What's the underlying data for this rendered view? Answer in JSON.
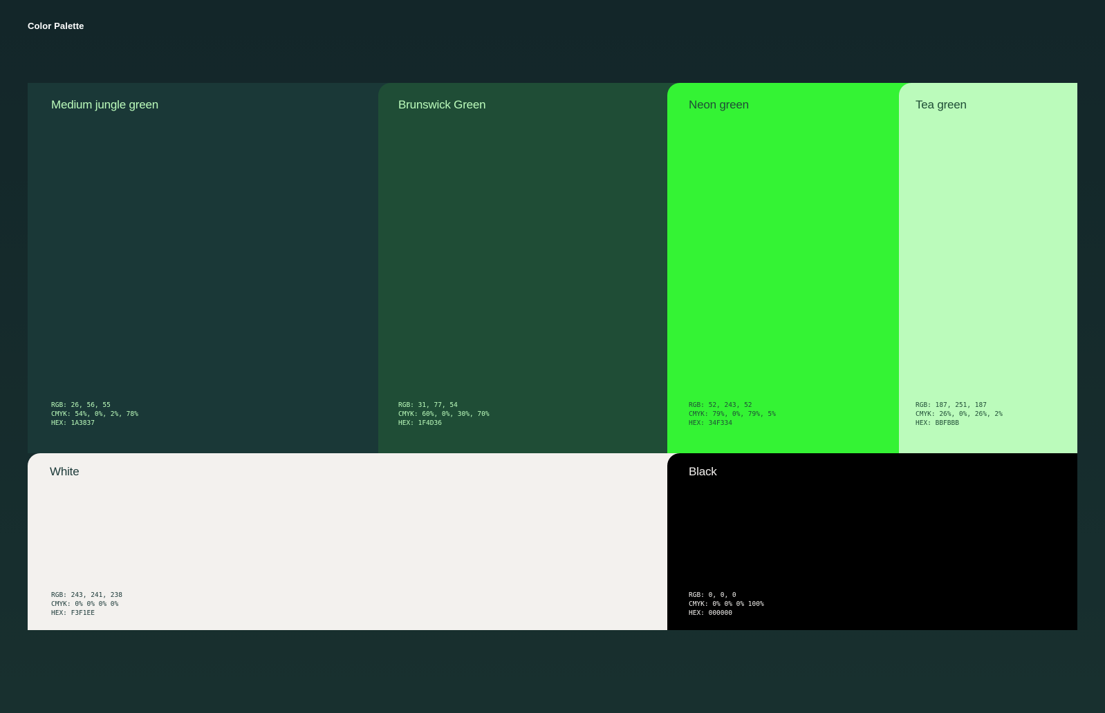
{
  "page": {
    "title": "Color Palette",
    "background": "#132629"
  },
  "swatches": [
    {
      "name": "Medium jungle green",
      "color": "#1A3837",
      "text_color": "#BBFBBB",
      "rgb": "RGB: 26, 56, 55",
      "cmyk": "CMYK: 54%, 0%, 2%, 78%",
      "hex": "HEX: 1A3837"
    },
    {
      "name": "Brunswick Green",
      "color": "#1F4D36",
      "text_color": "#BBFBBB",
      "rgb": "RGB: 31, 77, 54",
      "cmyk": "CMYK: 60%, 0%, 30%, 70%",
      "hex": "HEX: 1F4D36"
    },
    {
      "name": "Neon green",
      "color": "#34F334",
      "text_color": "#1F4D36",
      "rgb": "RGB: 52, 243, 52",
      "cmyk": "CMYK: 79%, 0%, 79%, 5%",
      "hex": "HEX: 34F334"
    },
    {
      "name": "Tea green",
      "color": "#BBFBBB",
      "text_color": "#1F4D36",
      "rgb": "RGB: 187, 251, 187",
      "cmyk": "CMYK: 26%, 0%, 26%, 2%",
      "hex": "HEX: BBFBBB"
    },
    {
      "name": "White",
      "color": "#F3F1EE",
      "text_color": "#1A3837",
      "rgb": "RGB: 243, 241, 238",
      "cmyk": "CMYK: 0% 0% 0% 0%",
      "hex": "HEX: F3F1EE"
    },
    {
      "name": "Black",
      "color": "#000000",
      "text_color": "#F3F1EE",
      "rgb": "RGB: 0, 0, 0",
      "cmyk": "CMYK: 0% 0% 0% 100%",
      "hex": "HEX: 000000"
    }
  ]
}
